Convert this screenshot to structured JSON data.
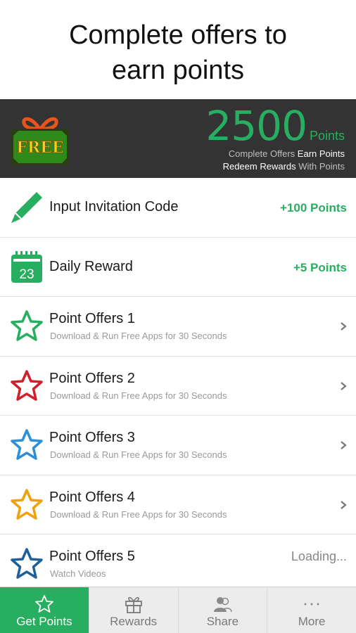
{
  "headline": {
    "line1": "Complete offers to",
    "line2": "earn points"
  },
  "banner": {
    "gift_label": "FREE",
    "points_value": "2500",
    "points_unit": "Points",
    "line1_dim": "Complete Offers",
    "line1_bright": "Earn Points",
    "line2_bright": "Redeem Rewards",
    "line2_dim": "With Points"
  },
  "list": {
    "items": [
      {
        "title": "Input Invitation Code",
        "right": "+100 Points",
        "icon": "pencil-icon"
      },
      {
        "title": "Daily Reward",
        "right": "+5 Points",
        "icon": "calendar-icon",
        "calendar_day": "23"
      },
      {
        "title": "Point Offers 1",
        "subtitle": "Download & Run Free Apps for 30 Seconds",
        "icon": "star-icon",
        "color": "#27ae60"
      },
      {
        "title": "Point Offers 2",
        "subtitle": "Download & Run Free Apps for 30 Seconds",
        "icon": "star-icon",
        "color": "#d0202a"
      },
      {
        "title": "Point Offers 3",
        "subtitle": "Download & Run Free Apps for 30 Seconds",
        "icon": "star-icon",
        "color": "#2e8fd8"
      },
      {
        "title": "Point Offers 4",
        "subtitle": "Download & Run Free Apps for 30 Seconds",
        "icon": "star-icon",
        "color": "#f0a10f"
      },
      {
        "title": "Point Offers 5",
        "subtitle": "Watch Videos",
        "right": "Loading...",
        "icon": "star-icon",
        "color": "#1f5f9a"
      }
    ]
  },
  "tabs": [
    {
      "label": "Get Points",
      "icon": "star-outline-icon",
      "active": true
    },
    {
      "label": "Rewards",
      "icon": "gift-icon",
      "active": false
    },
    {
      "label": "Share",
      "icon": "people-icon",
      "active": false
    },
    {
      "label": "More",
      "icon": "more-dots-icon",
      "active": false
    }
  ],
  "colors": {
    "accent_green": "#27ae60",
    "banner_bg": "#333333",
    "tabbar_bg": "#ececec"
  }
}
